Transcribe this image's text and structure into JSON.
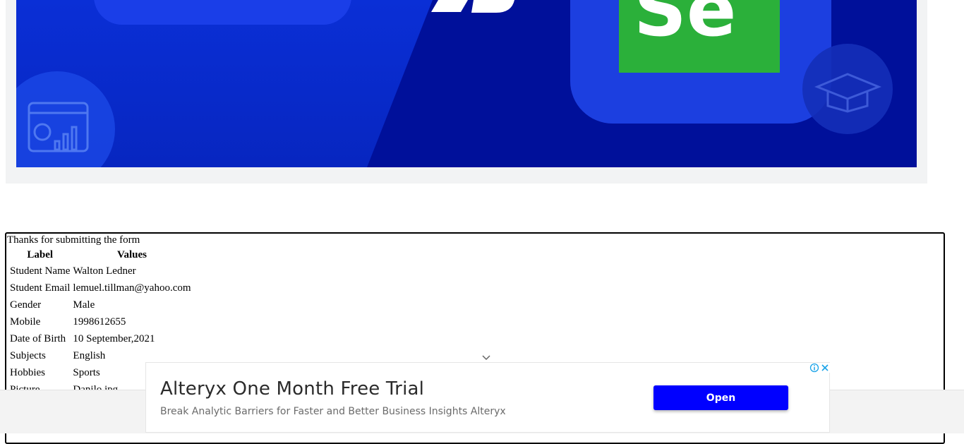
{
  "banner": {
    "logo_text": "Se",
    "colors": {
      "background": "#0726c0",
      "accent_dark": "#00109a",
      "logo_green": "#2bb03a"
    }
  },
  "modal": {
    "title": "Thanks for submitting the form",
    "columns": [
      "Label",
      "Values"
    ],
    "rows": [
      {
        "label": "Student Name",
        "value": "Walton Ledner"
      },
      {
        "label": "Student Email",
        "value": "lemuel.tillman@yahoo.com"
      },
      {
        "label": "Gender",
        "value": "Male"
      },
      {
        "label": "Mobile",
        "value": "1998612655"
      },
      {
        "label": "Date of Birth",
        "value": "10 September,2021"
      },
      {
        "label": "Subjects",
        "value": "English"
      },
      {
        "label": "Hobbies",
        "value": "Sports"
      },
      {
        "label": "Picture",
        "value": "Danilo.jpg"
      }
    ]
  },
  "ad": {
    "title": "Alteryx One Month Free Trial",
    "subtitle": "Break Analytic Barriers for Faster and Better Business Insights Alteryx",
    "open_label": "Open",
    "colors": {
      "button": "#0000ff"
    }
  }
}
